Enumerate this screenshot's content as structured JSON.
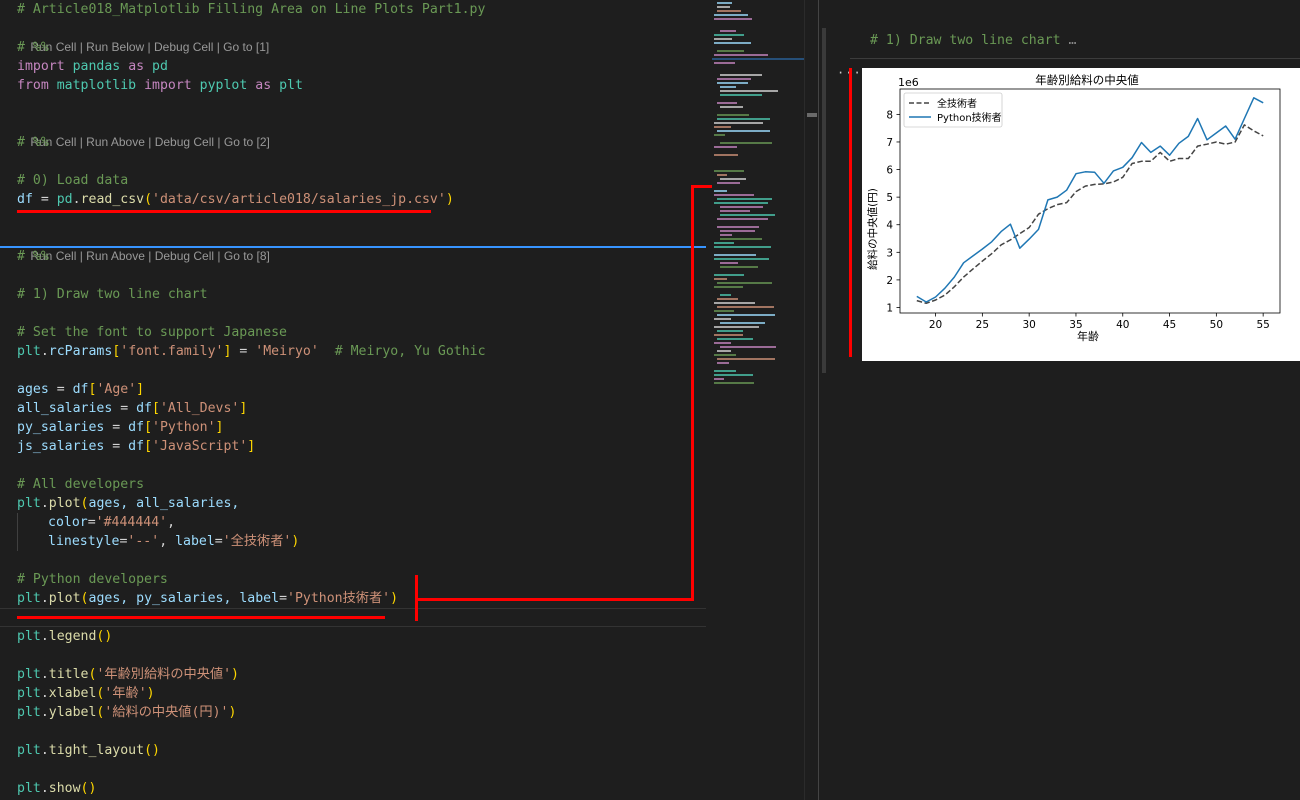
{
  "editor": {
    "code_lens": [
      {
        "items": [
          "Run Cell",
          "Run Below",
          "Debug Cell",
          "Go to [1]"
        ]
      },
      {
        "items": [
          "Run Cell",
          "Run Above",
          "Debug Cell",
          "Go to [2]"
        ]
      },
      {
        "items": [
          "Run Cell",
          "Run Above",
          "Debug Cell",
          "Go to [8]"
        ]
      }
    ],
    "lines": {
      "l_title": "# Article018_Matplotlib Filling Area on Line Plots Part1.py",
      "l_cell1": "# %%",
      "l_import1": {
        "kw": "import",
        "mod": "pandas",
        "as": "as",
        "alias": "pd"
      },
      "l_import2": {
        "kw1": "from",
        "mod": "matplotlib",
        "kw2": "import",
        "sub": "pyplot",
        "as": "as",
        "alias": "plt"
      },
      "l_cell2": "# %%",
      "l_load_comment": "# 0) Load data",
      "l_load": {
        "var": "df",
        "eq": " = ",
        "mod": "pd",
        "fn": "read_csv",
        "arg": "'data/csv/article018/salaries_jp.csv'"
      },
      "l_cell3": "# %%",
      "l_draw_comment": "# 1) Draw two line chart",
      "l_font_comment": "# Set the font to support Japanese",
      "l_rc": {
        "mod": "plt",
        "attr": "rcParams",
        "key": "'font.family'",
        "val": "'Meiryo'",
        "comment": "# Meiryo, Yu Gothic"
      },
      "l_ages": {
        "var": "ages",
        "src": "df",
        "key": "'Age'"
      },
      "l_all": {
        "var": "all_salaries",
        "src": "df",
        "key": "'All_Devs'"
      },
      "l_py": {
        "var": "py_salaries",
        "src": "df",
        "key": "'Python'"
      },
      "l_js": {
        "var": "js_salaries",
        "src": "df",
        "key": "'JavaScript'"
      },
      "l_all_comment": "# All developers",
      "l_plot1a": {
        "mod": "plt",
        "fn": "plot",
        "args": "ages, all_salaries,"
      },
      "l_plot1b": {
        "kw": "color",
        "val": "'#444444'"
      },
      "l_plot1c": {
        "kw1": "linestyle",
        "val1": "'--'",
        "kw2": "label",
        "val2": "'全技術者'"
      },
      "l_py_comment": "# Python developers",
      "l_plot2": {
        "mod": "plt",
        "fn": "plot",
        "args": "ages, py_salaries, ",
        "kw": "label",
        "val": "'Python技術者'"
      },
      "l_legend": {
        "mod": "plt",
        "fn": "legend"
      },
      "l_title_call": {
        "mod": "plt",
        "fn": "title",
        "val": "'年齢別給料の中央値'"
      },
      "l_xlabel": {
        "mod": "plt",
        "fn": "xlabel",
        "val": "'年齢'"
      },
      "l_ylabel": {
        "mod": "plt",
        "fn": "ylabel",
        "val": "'給料の中央値(円)'"
      },
      "l_tight": {
        "mod": "plt",
        "fn": "tight_layout"
      },
      "l_show": {
        "mod": "plt",
        "fn": "show"
      }
    }
  },
  "output": {
    "header": "# 1) Draw two line chart",
    "header_ellipsis": "…",
    "more_label": "…"
  },
  "colors": {
    "annotation": "#ff0000",
    "cell_separator": "#3794ff",
    "python_line": "#1f77b4",
    "all_devs_line": "#444444"
  },
  "chart_data": {
    "type": "line",
    "title": "年齢別給料の中央値",
    "xlabel": "年齢",
    "ylabel": "給料の中央値(円)",
    "y_offset_label": "1e6",
    "xlim": [
      16.2,
      56.8
    ],
    "ylim": [
      0.8,
      8.92
    ],
    "xticks": [
      20,
      25,
      30,
      35,
      40,
      45,
      50,
      55
    ],
    "yticks": [
      1,
      2,
      3,
      4,
      5,
      6,
      7,
      8
    ],
    "grid": false,
    "legend_position": "top-left",
    "x": [
      18,
      19,
      20,
      21,
      22,
      23,
      24,
      25,
      26,
      27,
      28,
      29,
      30,
      31,
      32,
      33,
      34,
      35,
      36,
      37,
      38,
      39,
      40,
      41,
      42,
      43,
      44,
      45,
      46,
      47,
      48,
      49,
      50,
      51,
      52,
      53,
      54,
      55
    ],
    "series": [
      {
        "name": "全技術者",
        "style": "dashed",
        "color": "#444444",
        "values": [
          1.25,
          1.15,
          1.27,
          1.45,
          1.75,
          2.1,
          2.4,
          2.68,
          2.95,
          3.27,
          3.45,
          3.68,
          3.9,
          4.38,
          4.58,
          4.73,
          4.8,
          5.2,
          5.4,
          5.46,
          5.48,
          5.55,
          5.72,
          6.22,
          6.3,
          6.3,
          6.62,
          6.3,
          6.4,
          6.4,
          6.85,
          6.92,
          7.0,
          6.92,
          7.0,
          7.62,
          7.4,
          7.22
        ]
      },
      {
        "name": "Python技術者",
        "style": "solid",
        "color": "#1f77b4",
        "values": [
          1.4,
          1.2,
          1.38,
          1.7,
          2.1,
          2.62,
          2.87,
          3.12,
          3.38,
          3.75,
          4.02,
          3.15,
          3.48,
          3.83,
          4.9,
          5.0,
          5.25,
          5.85,
          5.92,
          5.9,
          5.5,
          5.95,
          6.08,
          6.43,
          6.98,
          6.62,
          6.85,
          6.52,
          6.95,
          7.2,
          7.85,
          7.08,
          7.33,
          7.58,
          7.1,
          7.85,
          8.6,
          8.42
        ]
      }
    ]
  }
}
